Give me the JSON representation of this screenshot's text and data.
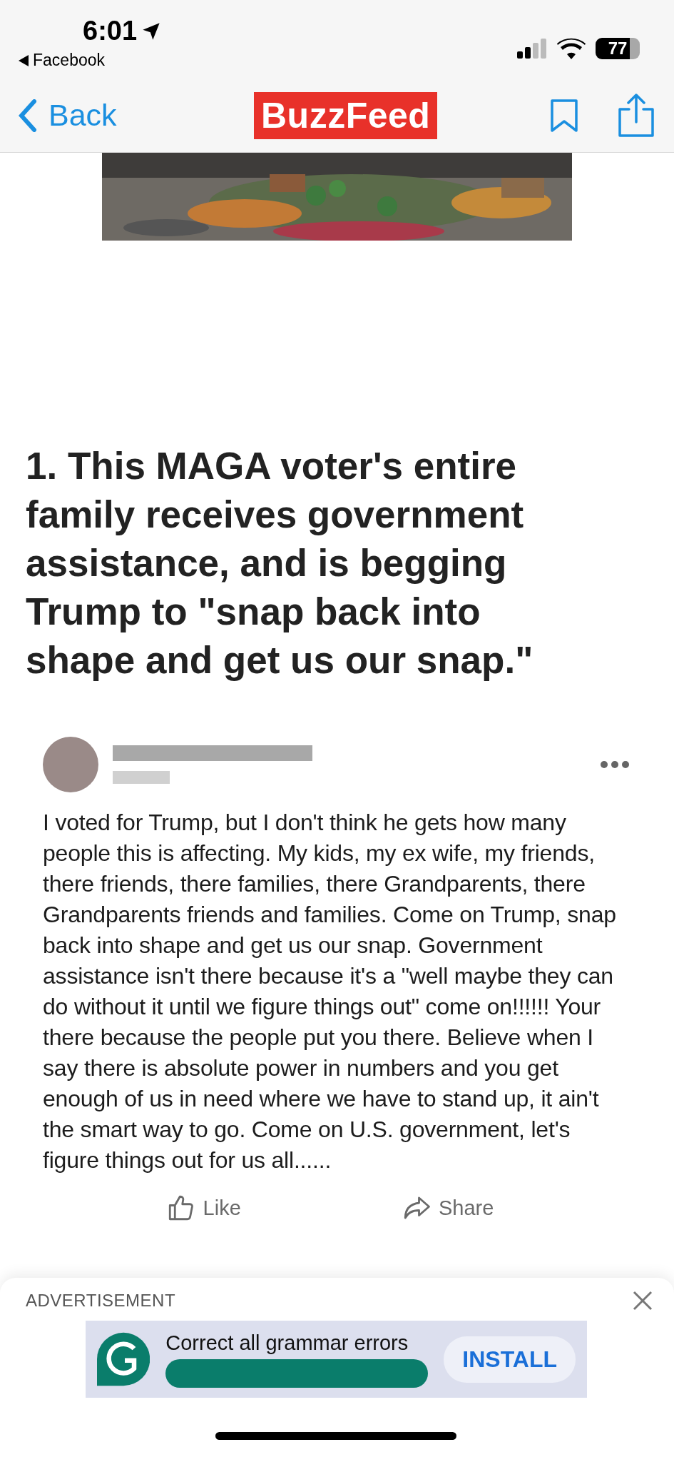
{
  "status_bar": {
    "time": "6:01",
    "back_app": "Facebook",
    "battery": "77"
  },
  "nav": {
    "back": "Back",
    "logo": "BuzzFeed"
  },
  "headline": "1. This MAGA voter's entire family receives government assistance, and is begging Trump to \"snap back into shape and get us our snap.\"",
  "post": {
    "body": "I voted for Trump, but I don't think he gets how many people this is affecting. My kids, my ex wife, my friends, there friends, there families, there Grandparents, there Grandparents friends and families. Come on Trump, snap back into shape and get us our snap. Government assistance isn't there because it's a \"well maybe they can do without it until we figure things out\" come on!!!!!! Your there because the people put you there. Believe when I say there is absolute power in numbers and you get enough of us in need where we have to stand up, it ain't the smart way to go. Come on U.S. government, let's figure things out for us all......",
    "actions": [
      {
        "kind": "like",
        "label": "Like"
      },
      {
        "kind": "share",
        "label": "Share"
      }
    ]
  },
  "ad": {
    "label": "ADVERTISEMENT",
    "text": "Correct all grammar errors",
    "button": "INSTALL"
  }
}
